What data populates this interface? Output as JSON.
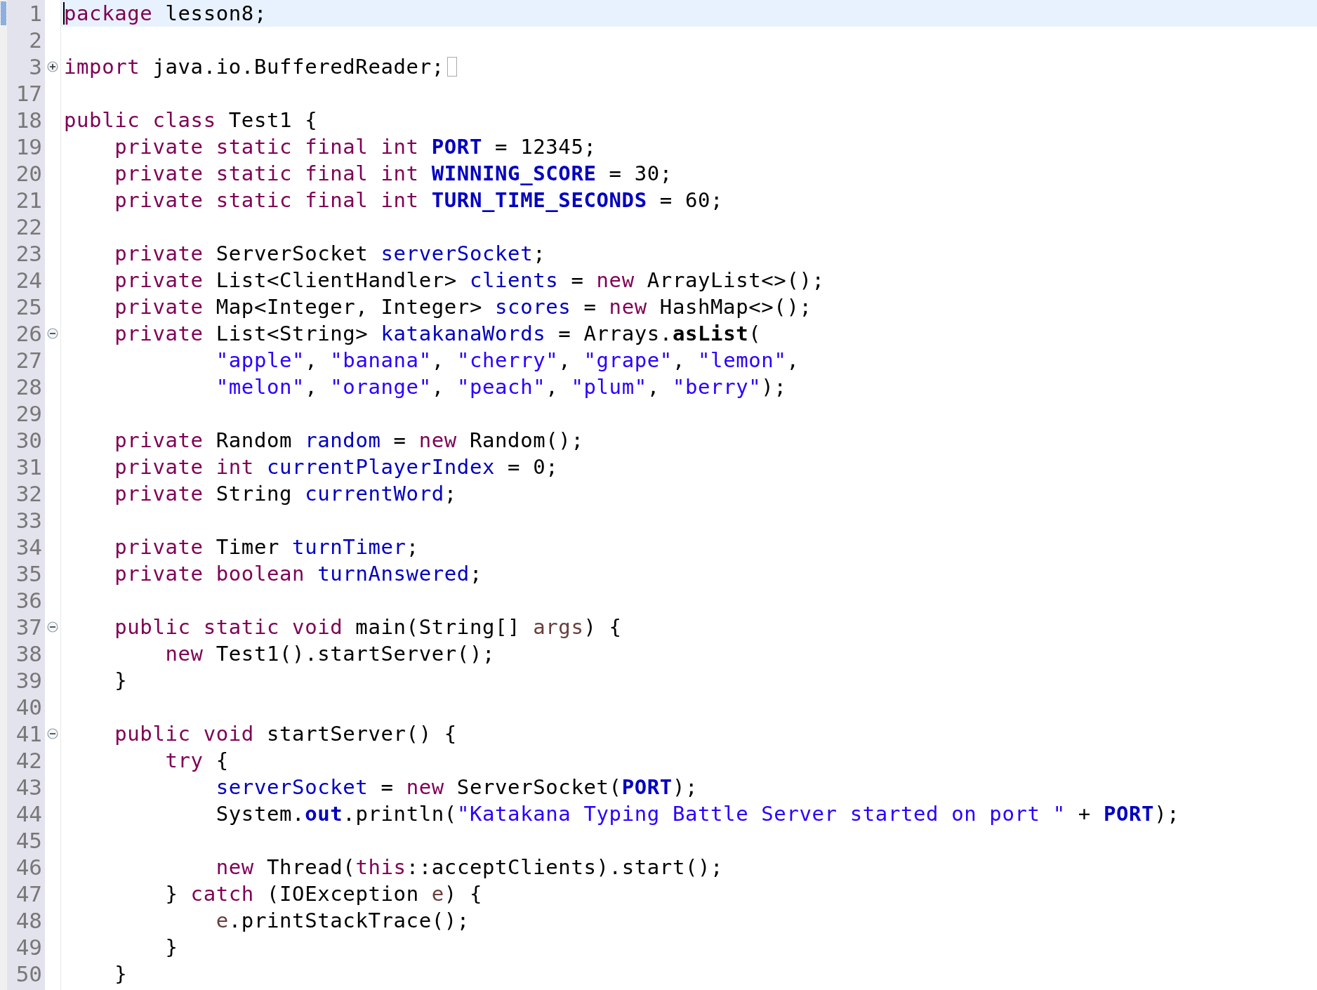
{
  "editor": {
    "lines": [
      {
        "number": "1",
        "current": true,
        "tokens": [
          {
            "kind": "kw",
            "text": "package"
          },
          {
            "kind": "plain",
            "text": " lesson8;"
          }
        ]
      },
      {
        "number": "2",
        "current": false
      },
      {
        "number": "3",
        "current": false,
        "folded": true,
        "tokens": [
          {
            "kind": "kw",
            "text": "import"
          },
          {
            "kind": "plain",
            "text": " java.io.BufferedReader;"
          }
        ]
      },
      {
        "number": "17",
        "current": false
      },
      {
        "number": "18",
        "current": false,
        "tokens": [
          {
            "kind": "kw",
            "text": "public class"
          },
          {
            "kind": "plain",
            "text": " Test1 {"
          }
        ]
      },
      {
        "number": "19",
        "current": false,
        "tokens": [
          {
            "kind": "kw",
            "text": "    private static final int"
          },
          {
            "kind": "const",
            "text": " PORT"
          },
          {
            "kind": "plain",
            "text": " = 12345;"
          }
        ]
      },
      {
        "number": "20",
        "current": false,
        "tokens": [
          {
            "kind": "kw",
            "text": "    private static final int"
          },
          {
            "kind": "const",
            "text": " WINNING_SCORE"
          },
          {
            "kind": "plain",
            "text": " = 30;"
          }
        ]
      },
      {
        "number": "21",
        "current": false,
        "tokens": [
          {
            "kind": "kw",
            "text": "    private static final int"
          },
          {
            "kind": "const",
            "text": " TURN_TIME_SECONDS"
          },
          {
            "kind": "plain",
            "text": " = 60;"
          }
        ]
      },
      {
        "number": "22",
        "current": false
      },
      {
        "number": "23",
        "current": false,
        "tokens": [
          {
            "kind": "kw",
            "text": "    private"
          },
          {
            "kind": "plain",
            "text": " ServerSocket "
          },
          {
            "kind": "field",
            "text": "serverSocket"
          },
          {
            "kind": "plain",
            "text": ";"
          }
        ]
      },
      {
        "number": "24",
        "current": false,
        "tokens": [
          {
            "kind": "kw",
            "text": "    private"
          },
          {
            "kind": "plain",
            "text": " List<ClientHandler> "
          },
          {
            "kind": "field",
            "text": "clients"
          },
          {
            "kind": "plain",
            "text": " = "
          },
          {
            "kind": "kw",
            "text": "new"
          },
          {
            "kind": "plain",
            "text": " ArrayList<>();"
          }
        ]
      },
      {
        "number": "25",
        "current": false,
        "tokens": [
          {
            "kind": "kw",
            "text": "    private"
          },
          {
            "kind": "plain",
            "text": " Map<Integer, Integer> "
          },
          {
            "kind": "field",
            "text": "scores"
          },
          {
            "kind": "plain",
            "text": " = "
          },
          {
            "kind": "kw",
            "text": "new"
          },
          {
            "kind": "plain",
            "text": " HashMap<>();"
          }
        ]
      },
      {
        "number": "26",
        "current": false,
        "folded": false,
        "tokens": [
          {
            "kind": "kw",
            "text": "    private"
          },
          {
            "kind": "plain",
            "text": " List<String> "
          },
          {
            "kind": "field",
            "text": "katakanaWords"
          },
          {
            "kind": "plain",
            "text": " = Arrays."
          },
          {
            "kind": "smethod",
            "text": "asList"
          },
          {
            "kind": "plain",
            "text": "("
          }
        ]
      },
      {
        "number": "27",
        "current": false,
        "tokens": [
          {
            "kind": "string",
            "text": "            \"apple\""
          },
          {
            "kind": "plain",
            "text": ", "
          },
          {
            "kind": "string",
            "text": "\"banana\""
          },
          {
            "kind": "plain",
            "text": ", "
          },
          {
            "kind": "string",
            "text": "\"cherry\""
          },
          {
            "kind": "plain",
            "text": ", "
          },
          {
            "kind": "string",
            "text": "\"grape\""
          },
          {
            "kind": "plain",
            "text": ", "
          },
          {
            "kind": "string",
            "text": "\"lemon\""
          },
          {
            "kind": "plain",
            "text": ","
          }
        ]
      },
      {
        "number": "28",
        "current": false,
        "tokens": [
          {
            "kind": "string",
            "text": "            \"melon\""
          },
          {
            "kind": "plain",
            "text": ", "
          },
          {
            "kind": "string",
            "text": "\"orange\""
          },
          {
            "kind": "plain",
            "text": ", "
          },
          {
            "kind": "string",
            "text": "\"peach\""
          },
          {
            "kind": "plain",
            "text": ", "
          },
          {
            "kind": "string",
            "text": "\"plum\""
          },
          {
            "kind": "plain",
            "text": ", "
          },
          {
            "kind": "string",
            "text": "\"berry\""
          },
          {
            "kind": "plain",
            "text": ");"
          }
        ]
      },
      {
        "number": "29",
        "current": false
      },
      {
        "number": "30",
        "current": false,
        "tokens": [
          {
            "kind": "kw",
            "text": "    private"
          },
          {
            "kind": "plain",
            "text": " Random "
          },
          {
            "kind": "field",
            "text": "random"
          },
          {
            "kind": "plain",
            "text": " = "
          },
          {
            "kind": "kw",
            "text": "new"
          },
          {
            "kind": "plain",
            "text": " Random();"
          }
        ]
      },
      {
        "number": "31",
        "current": false,
        "tokens": [
          {
            "kind": "kw",
            "text": "    private int"
          },
          {
            "kind": "field",
            "text": " currentPlayerIndex"
          },
          {
            "kind": "plain",
            "text": " = 0;"
          }
        ]
      },
      {
        "number": "32",
        "current": false,
        "tokens": [
          {
            "kind": "kw",
            "text": "    private"
          },
          {
            "kind": "plain",
            "text": " String "
          },
          {
            "kind": "field",
            "text": "currentWord"
          },
          {
            "kind": "plain",
            "text": ";"
          }
        ]
      },
      {
        "number": "33",
        "current": false
      },
      {
        "number": "34",
        "current": false,
        "tokens": [
          {
            "kind": "kw",
            "text": "    private"
          },
          {
            "kind": "plain",
            "text": " Timer "
          },
          {
            "kind": "field",
            "text": "turnTimer"
          },
          {
            "kind": "plain",
            "text": ";"
          }
        ]
      },
      {
        "number": "35",
        "current": false,
        "tokens": [
          {
            "kind": "kw",
            "text": "    private boolean"
          },
          {
            "kind": "field",
            "text": " turnAnswered"
          },
          {
            "kind": "plain",
            "text": ";"
          }
        ]
      },
      {
        "number": "36",
        "current": false
      },
      {
        "number": "37",
        "current": false,
        "folded": false,
        "tokens": [
          {
            "kind": "kw",
            "text": "    public static void"
          },
          {
            "kind": "plain",
            "text": " main(String[] "
          },
          {
            "kind": "param",
            "text": "args"
          },
          {
            "kind": "plain",
            "text": ") {"
          }
        ]
      },
      {
        "number": "38",
        "current": false,
        "tokens": [
          {
            "kind": "kw",
            "text": "        new"
          },
          {
            "kind": "plain",
            "text": " Test1().startServer();"
          }
        ]
      },
      {
        "number": "39",
        "current": false,
        "tokens": [
          {
            "kind": "plain",
            "text": "    }"
          }
        ]
      },
      {
        "number": "40",
        "current": false
      },
      {
        "number": "41",
        "current": false,
        "folded": false,
        "tokens": [
          {
            "kind": "kw",
            "text": "    public void"
          },
          {
            "kind": "plain",
            "text": " startServer() {"
          }
        ]
      },
      {
        "number": "42",
        "current": false,
        "tokens": [
          {
            "kind": "kw",
            "text": "        try"
          },
          {
            "kind": "plain",
            "text": " {"
          }
        ]
      },
      {
        "number": "43",
        "current": false,
        "tokens": [
          {
            "kind": "field",
            "text": "            serverSocket"
          },
          {
            "kind": "plain",
            "text": " = "
          },
          {
            "kind": "kw",
            "text": "new"
          },
          {
            "kind": "plain",
            "text": " ServerSocket("
          },
          {
            "kind": "const",
            "text": "PORT"
          },
          {
            "kind": "plain",
            "text": ");"
          }
        ]
      },
      {
        "number": "44",
        "current": false,
        "tokens": [
          {
            "kind": "plain",
            "text": "            System."
          },
          {
            "kind": "const",
            "text": "out"
          },
          {
            "kind": "plain",
            "text": ".println("
          },
          {
            "kind": "string",
            "text": "\"Katakana Typing Battle Server started on port \""
          },
          {
            "kind": "plain",
            "text": " + "
          },
          {
            "kind": "const",
            "text": "PORT"
          },
          {
            "kind": "plain",
            "text": ");"
          }
        ]
      },
      {
        "number": "45",
        "current": false
      },
      {
        "number": "46",
        "current": false,
        "tokens": [
          {
            "kind": "kw",
            "text": "            new"
          },
          {
            "kind": "plain",
            "text": " Thread("
          },
          {
            "kind": "kw",
            "text": "this"
          },
          {
            "kind": "plain",
            "text": "::acceptClients).start();"
          }
        ]
      },
      {
        "number": "47",
        "current": false,
        "tokens": [
          {
            "kind": "plain",
            "text": "        } "
          },
          {
            "kind": "kw",
            "text": "catch"
          },
          {
            "kind": "plain",
            "text": " (IOException "
          },
          {
            "kind": "param",
            "text": "e"
          },
          {
            "kind": "plain",
            "text": ") {"
          }
        ]
      },
      {
        "number": "48",
        "current": false,
        "tokens": [
          {
            "kind": "param",
            "text": "            e"
          },
          {
            "kind": "plain",
            "text": ".printStackTrace();"
          }
        ]
      },
      {
        "number": "49",
        "current": false,
        "tokens": [
          {
            "kind": "plain",
            "text": "        }"
          }
        ]
      },
      {
        "number": "50",
        "current": false,
        "tokens": [
          {
            "kind": "plain",
            "text": "    }"
          }
        ]
      }
    ]
  }
}
